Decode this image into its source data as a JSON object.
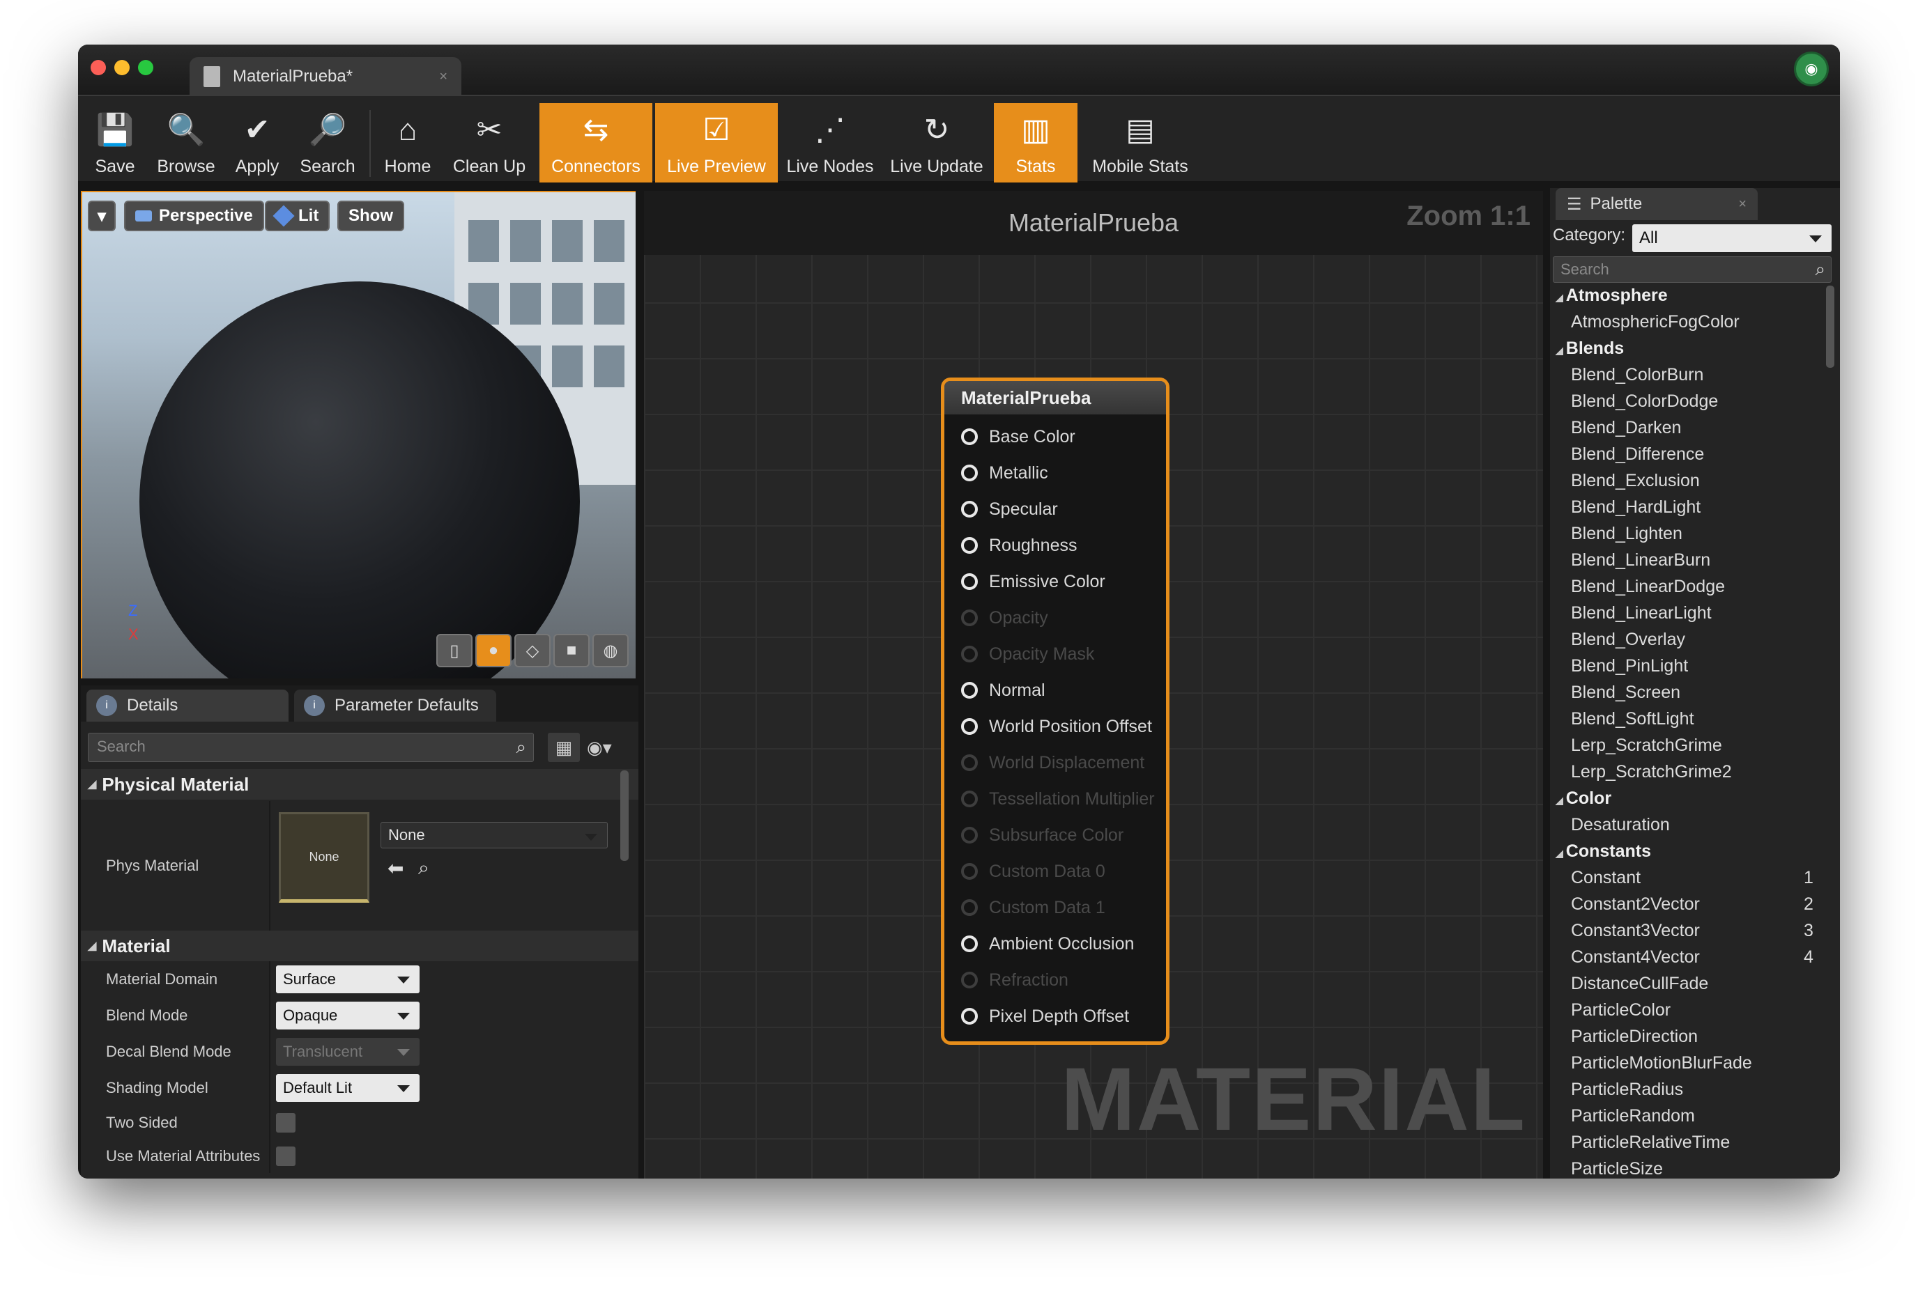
{
  "window": {
    "tab_title": "MaterialPrueba*",
    "close_glyph": "×",
    "engine_logo_glyph": "◉",
    "traffic_colors": [
      "#fc5f57",
      "#fdbc2e",
      "#28c840"
    ],
    "accent": "#e78e1b"
  },
  "toolbar": {
    "buttons": [
      {
        "label": "Save",
        "icon": "💾",
        "on": false
      },
      {
        "label": "Browse",
        "icon": "🔍",
        "on": false
      },
      {
        "label": "Apply",
        "icon": "✔",
        "on": false
      },
      {
        "label": "Search",
        "icon": "🔎",
        "on": false
      },
      {
        "label": "Home",
        "icon": "⌂",
        "on": false
      },
      {
        "label": "Clean Up",
        "icon": "✂",
        "on": false
      },
      {
        "label": "Connectors",
        "icon": "⇆",
        "on": true
      },
      {
        "label": "Live Preview",
        "icon": "☑",
        "on": true
      },
      {
        "label": "Live Nodes",
        "icon": "⋰",
        "on": false
      },
      {
        "label": "Live Update",
        "icon": "↻",
        "on": false
      },
      {
        "label": "Stats",
        "icon": "▥",
        "on": true
      },
      {
        "label": "Mobile Stats",
        "icon": "▤",
        "on": false
      }
    ]
  },
  "viewport": {
    "menu_glyph": "▾",
    "perspective": "Perspective",
    "lit": "Lit",
    "show": "Show",
    "axis_z": "Z",
    "axis_x": "X",
    "preview_shapes": [
      {
        "name": "cylinder",
        "glyph": "▯",
        "on": false
      },
      {
        "name": "sphere",
        "glyph": "●",
        "on": true
      },
      {
        "name": "plane",
        "glyph": "◇",
        "on": false
      },
      {
        "name": "cube",
        "glyph": "■",
        "on": false
      },
      {
        "name": "teapot",
        "glyph": "◍",
        "on": false
      }
    ]
  },
  "details": {
    "tab_details": "Details",
    "tab_params": "Parameter Defaults",
    "info_glyph": "i",
    "search_placeholder": "Search",
    "search_glyph": "⌕",
    "grid_glyph": "▦",
    "eye_glyph": "◉▾",
    "physical_section": "Physical Material",
    "phys_label": "Phys Material",
    "phys_thumb": "None",
    "phys_value": "None",
    "back_glyph": "⬅",
    "section_triangle": "◢",
    "material_section": "Material",
    "rows": [
      {
        "label": "Material Domain",
        "value": "Surface",
        "type": "dropdown",
        "disabled": false
      },
      {
        "label": "Blend Mode",
        "value": "Opaque",
        "type": "dropdown",
        "disabled": false
      },
      {
        "label": "Decal Blend Mode",
        "value": "Translucent",
        "type": "dropdown",
        "disabled": true
      },
      {
        "label": "Shading Model",
        "value": "Default Lit",
        "type": "dropdown",
        "disabled": false
      },
      {
        "label": "Two Sided",
        "value": "",
        "type": "checkbox",
        "disabled": false
      },
      {
        "label": "Use Material Attributes",
        "value": "",
        "type": "checkbox",
        "disabled": false
      }
    ]
  },
  "graph": {
    "title": "MaterialPrueba",
    "zoom": "Zoom 1:1",
    "watermark": "MATERIAL",
    "node_title": "MaterialPrueba",
    "pins": [
      {
        "label": "Base Color",
        "enabled": true
      },
      {
        "label": "Metallic",
        "enabled": true
      },
      {
        "label": "Specular",
        "enabled": true
      },
      {
        "label": "Roughness",
        "enabled": true
      },
      {
        "label": "Emissive Color",
        "enabled": true
      },
      {
        "label": "Opacity",
        "enabled": false
      },
      {
        "label": "Opacity Mask",
        "enabled": false
      },
      {
        "label": "Normal",
        "enabled": true
      },
      {
        "label": "World Position Offset",
        "enabled": true
      },
      {
        "label": "World Displacement",
        "enabled": false
      },
      {
        "label": "Tessellation Multiplier",
        "enabled": false
      },
      {
        "label": "Subsurface Color",
        "enabled": false
      },
      {
        "label": "Custom Data 0",
        "enabled": false
      },
      {
        "label": "Custom Data 1",
        "enabled": false
      },
      {
        "label": "Ambient Occlusion",
        "enabled": true
      },
      {
        "label": "Refraction",
        "enabled": false
      },
      {
        "label": "Pixel Depth Offset",
        "enabled": true
      }
    ]
  },
  "palette": {
    "tab": "Palette",
    "tab_icon_glyph": "☰",
    "category_label": "Category:",
    "category_value": "All",
    "search_placeholder": "Search",
    "expand_glyph": "◢",
    "items": [
      {
        "kind": "cat",
        "text": "Atmosphere"
      },
      {
        "kind": "item",
        "text": "AtmosphericFogColor"
      },
      {
        "kind": "cat",
        "text": "Blends"
      },
      {
        "kind": "item",
        "text": "Blend_ColorBurn"
      },
      {
        "kind": "item",
        "text": "Blend_ColorDodge"
      },
      {
        "kind": "item",
        "text": "Blend_Darken"
      },
      {
        "kind": "item",
        "text": "Blend_Difference"
      },
      {
        "kind": "item",
        "text": "Blend_Exclusion"
      },
      {
        "kind": "item",
        "text": "Blend_HardLight"
      },
      {
        "kind": "item",
        "text": "Blend_Lighten"
      },
      {
        "kind": "item",
        "text": "Blend_LinearBurn"
      },
      {
        "kind": "item",
        "text": "Blend_LinearDodge"
      },
      {
        "kind": "item",
        "text": "Blend_LinearLight"
      },
      {
        "kind": "item",
        "text": "Blend_Overlay"
      },
      {
        "kind": "item",
        "text": "Blend_PinLight"
      },
      {
        "kind": "item",
        "text": "Blend_Screen"
      },
      {
        "kind": "item",
        "text": "Blend_SoftLight"
      },
      {
        "kind": "item",
        "text": "Lerp_ScratchGrime"
      },
      {
        "kind": "item",
        "text": "Lerp_ScratchGrime2"
      },
      {
        "kind": "cat",
        "text": "Color"
      },
      {
        "kind": "item",
        "text": "Desaturation"
      },
      {
        "kind": "cat",
        "text": "Constants"
      },
      {
        "kind": "item",
        "text": "Constant",
        "key": "1"
      },
      {
        "kind": "item",
        "text": "Constant2Vector",
        "key": "2"
      },
      {
        "kind": "item",
        "text": "Constant3Vector",
        "key": "3"
      },
      {
        "kind": "item",
        "text": "Constant4Vector",
        "key": "4"
      },
      {
        "kind": "item",
        "text": "DistanceCullFade"
      },
      {
        "kind": "item",
        "text": "ParticleColor"
      },
      {
        "kind": "item",
        "text": "ParticleDirection"
      },
      {
        "kind": "item",
        "text": "ParticleMotionBlurFade"
      },
      {
        "kind": "item",
        "text": "ParticleRadius"
      },
      {
        "kind": "item",
        "text": "ParticleRandom"
      },
      {
        "kind": "item",
        "text": "ParticleRelativeTime"
      },
      {
        "kind": "item",
        "text": "ParticleSize"
      }
    ]
  }
}
